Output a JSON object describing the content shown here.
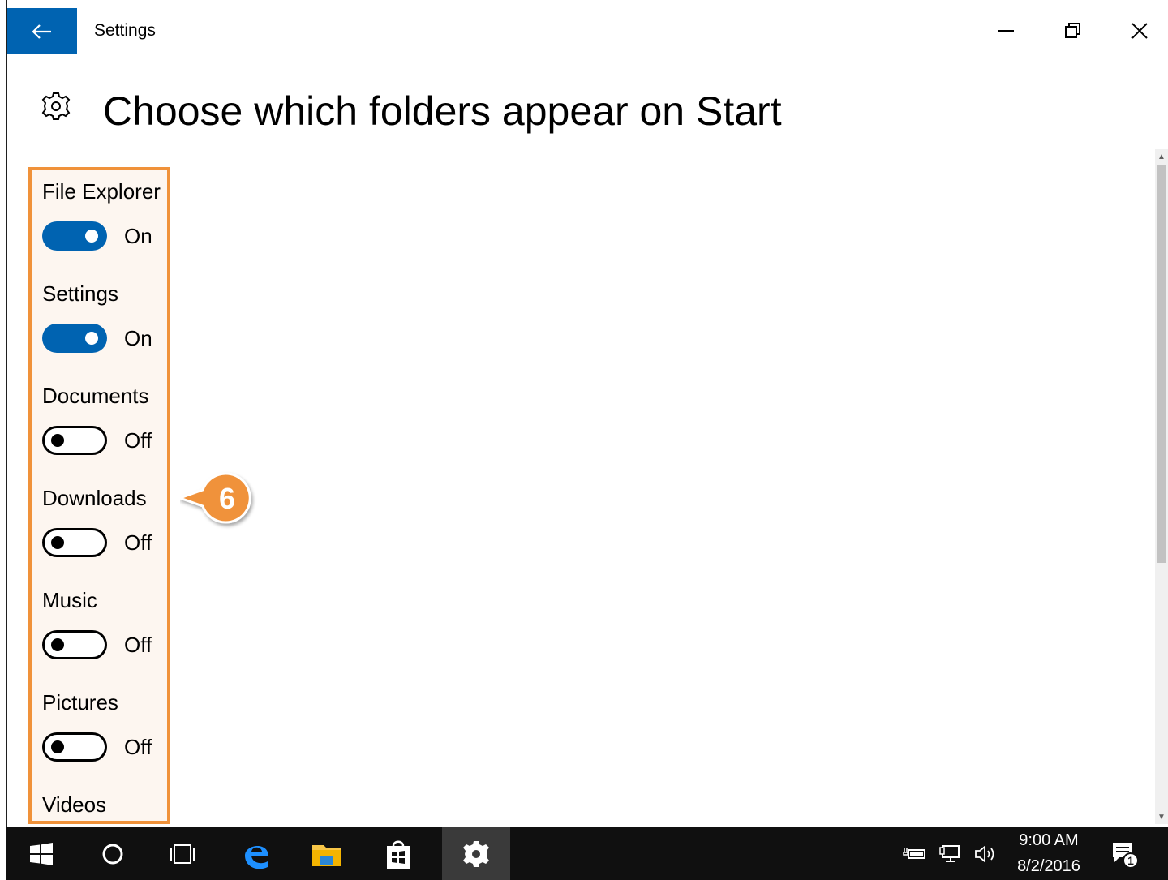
{
  "window": {
    "title": "Settings",
    "controls": [
      "minimize",
      "restore",
      "close"
    ]
  },
  "page": {
    "title": "Choose which folders appear on Start",
    "icon": "gear-icon"
  },
  "settings": [
    {
      "label": "File Explorer",
      "state": "On",
      "on": true
    },
    {
      "label": "Settings",
      "state": "On",
      "on": true
    },
    {
      "label": "Documents",
      "state": "Off",
      "on": false
    },
    {
      "label": "Downloads",
      "state": "Off",
      "on": false
    },
    {
      "label": "Music",
      "state": "Off",
      "on": false
    },
    {
      "label": "Pictures",
      "state": "Off",
      "on": false
    },
    {
      "label": "Videos"
    }
  ],
  "callout": {
    "number": "6",
    "color": "#f0923a"
  },
  "colors": {
    "accent": "#0063b1",
    "highlight_border": "#f0923a",
    "taskbar": "#101010"
  },
  "taskbar": {
    "items": [
      "start-icon",
      "cortana-icon",
      "task-view-icon",
      "edge-icon",
      "file-explorer-icon",
      "store-icon",
      "settings-icon"
    ],
    "tray": [
      "power-icon",
      "network-icon",
      "volume-icon"
    ],
    "time": "9:00 AM",
    "date": "8/2/2016",
    "notification_count": "1"
  }
}
